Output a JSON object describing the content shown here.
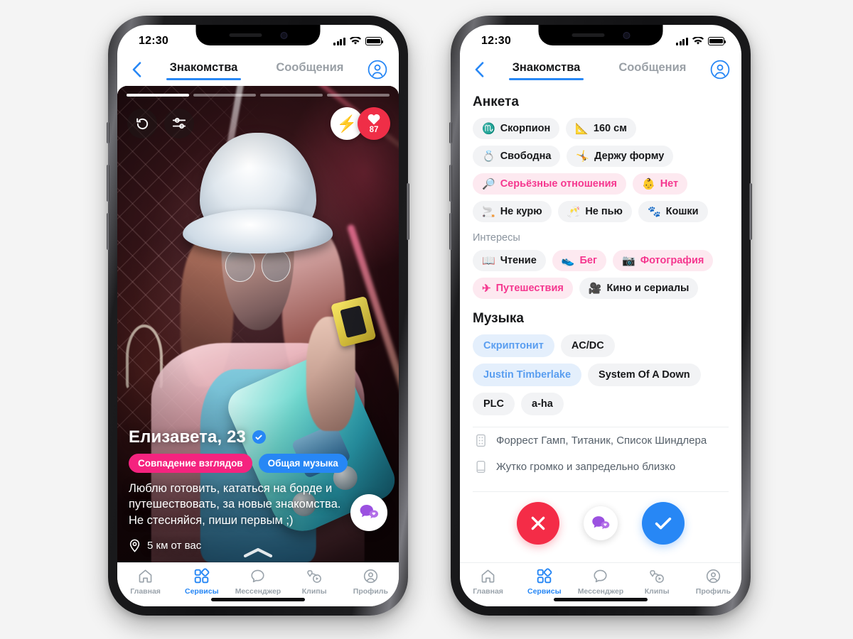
{
  "meta": {
    "background": "#f4f4f4",
    "accent_blue": "#2787f5",
    "accent_pink": "#f5237f",
    "accent_red": "#f42c47"
  },
  "status_bar": {
    "time": "12:30",
    "signal": "signal-bars-icon",
    "wifi": "wifi-icon",
    "battery": "battery-full-icon"
  },
  "header": {
    "back": "chevron-left-icon",
    "tabs": [
      {
        "label": "Знакомства",
        "active": true
      },
      {
        "label": "Сообщения",
        "active": false
      }
    ],
    "profile_icon": "account-circle-icon"
  },
  "phone1": {
    "card": {
      "progress": {
        "total": 4,
        "current": 1
      },
      "controls": {
        "rewind": "rewind-icon",
        "filters": "sliders-icon",
        "boost_emoji": "⚡",
        "likes_icon": "heart-icon",
        "likes_count": "87"
      },
      "name": "Елизавета, 23",
      "verified_icon": "verified-check-icon",
      "chips": [
        {
          "label": "Совпадение взглядов",
          "color": "pink"
        },
        {
          "label": "Общая музыка",
          "color": "blue"
        }
      ],
      "about": "Люблю готовить, кататься на борде и путешествовать, за новые знакомства. Не стесняйся, пиши первым ;)",
      "distance_icon": "location-pin-icon",
      "distance": "5 км от вас",
      "chat_fab_icon": "chat-heart-icon",
      "expand_icon": "chevron-up-icon"
    }
  },
  "phone2": {
    "anketa": {
      "title": "Анкета",
      "tags": [
        {
          "emoji": "♏",
          "label": "Скорпион",
          "style": "grey"
        },
        {
          "emoji": "📐",
          "label": "160 см",
          "style": "grey"
        },
        {
          "emoji": "💍",
          "label": "Свободна",
          "style": "grey"
        },
        {
          "emoji": "🤸",
          "label": "Держу форму",
          "style": "grey"
        },
        {
          "emoji": "🔎",
          "label": "Серьёзные отношения",
          "style": "pink"
        },
        {
          "emoji": "👶",
          "label": "Нет",
          "style": "pink"
        },
        {
          "emoji": "🚬",
          "label": "Не курю",
          "style": "grey"
        },
        {
          "emoji": "🥂",
          "label": "Не пью",
          "style": "grey"
        },
        {
          "emoji": "🐾",
          "label": "Кошки",
          "style": "grey"
        }
      ]
    },
    "interests": {
      "title": "Интересы",
      "tags": [
        {
          "emoji": "📖",
          "label": "Чтение",
          "style": "grey"
        },
        {
          "emoji": "👟",
          "label": "Бег",
          "style": "pink"
        },
        {
          "emoji": "📷",
          "label": "Фотография",
          "style": "pink"
        },
        {
          "emoji": "✈",
          "label": "Путешествия",
          "style": "pink"
        },
        {
          "emoji": "🎥",
          "label": "Кино и сериалы",
          "style": "grey"
        }
      ]
    },
    "music": {
      "title": "Музыка",
      "tags": [
        {
          "label": "Скриптонит",
          "style": "blue"
        },
        {
          "label": "AC/DC",
          "style": "grey"
        },
        {
          "label": "Justin Timberlake",
          "style": "blue"
        },
        {
          "label": "System Of A Down",
          "style": "grey"
        },
        {
          "label": "PLC",
          "style": "grey"
        },
        {
          "label": "a-ha",
          "style": "grey"
        }
      ]
    },
    "lists": [
      {
        "icon": "film-strip-icon",
        "text": "Форрест Гамп, Титаник, Список Шиндлера"
      },
      {
        "icon": "book-icon",
        "text": "Жутко громко и запредельно близко"
      }
    ],
    "actions": {
      "dislike": "close-x-icon",
      "message": "chat-heart-icon",
      "like": "check-icon"
    }
  },
  "tabbar": {
    "items": [
      {
        "label": "Главная",
        "icon": "home-icon",
        "active": false
      },
      {
        "label": "Сервисы",
        "icon": "services-grid-icon",
        "active": true
      },
      {
        "label": "Мессенджер",
        "icon": "chat-bubble-icon",
        "active": false
      },
      {
        "label": "Клипы",
        "icon": "clips-icon",
        "active": false
      },
      {
        "label": "Профиль",
        "icon": "account-circle-icon",
        "active": false
      }
    ]
  }
}
